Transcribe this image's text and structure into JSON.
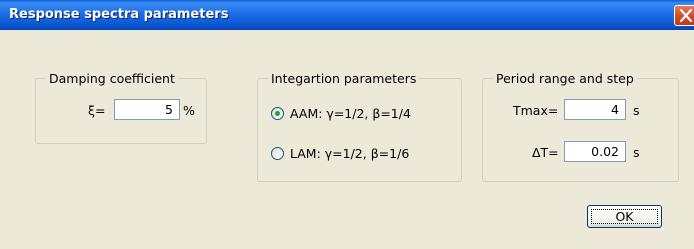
{
  "window": {
    "title": "Response spectra parameters"
  },
  "damping": {
    "legend": "Damping coefficient",
    "xi_label": "ξ=",
    "xi_value": "5",
    "unit": "%"
  },
  "integration": {
    "legend": "Integartion parameters",
    "options": [
      {
        "label": "AAM: γ=1/2, β=1/4",
        "selected": true
      },
      {
        "label": "LAM: γ=1/2, β=1/6",
        "selected": false
      }
    ]
  },
  "period": {
    "legend": "Period range and step",
    "tmax_label": "Tmax=",
    "tmax_value": "4",
    "tmax_unit": "s",
    "dt_label": "ΔT=",
    "dt_value": "0.02",
    "dt_unit": "s"
  },
  "buttons": {
    "ok": "OK"
  },
  "colors": {
    "titlebar": "#0a5fd6",
    "close_button": "#d24b2a",
    "dialog_bg": "#ece9d8",
    "radio_dot": "#21a121"
  },
  "icons": {
    "close": "close-icon"
  }
}
